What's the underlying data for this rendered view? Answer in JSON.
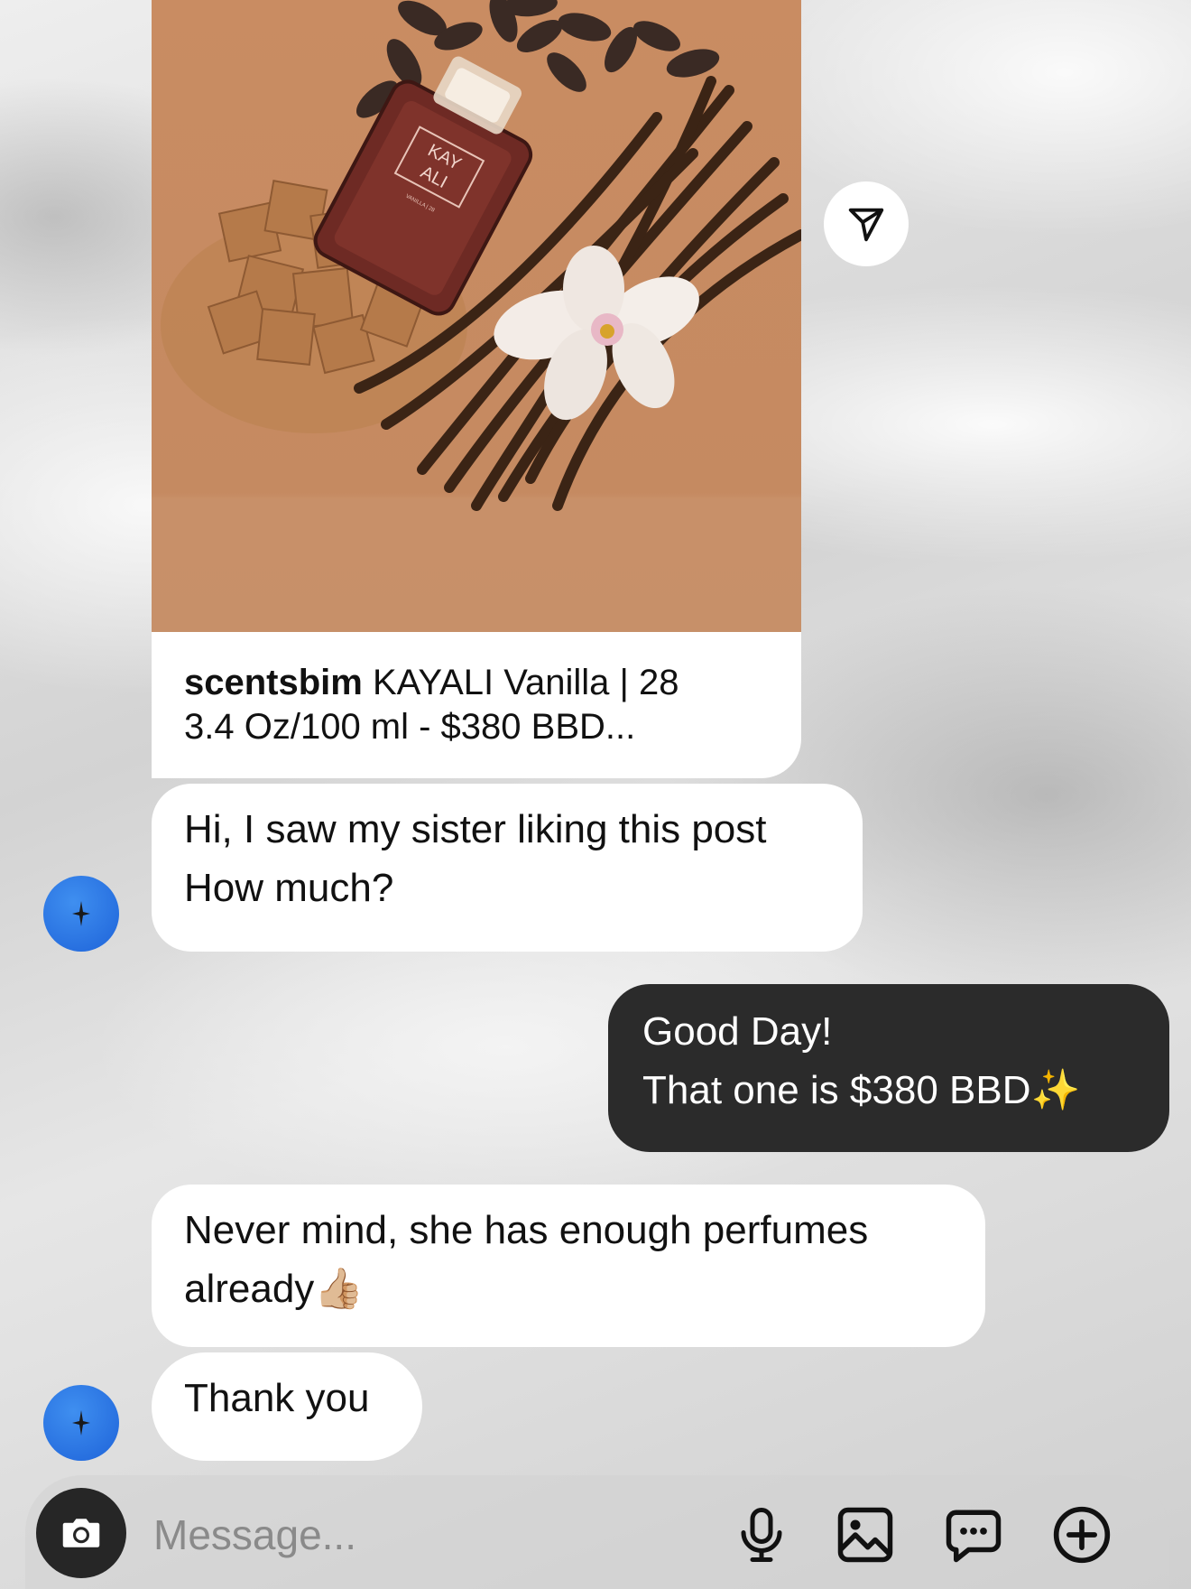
{
  "shared_post": {
    "username": "scentsbim",
    "caption_line1": "KAYALI Vanilla | 28",
    "caption_line2": "3.4 Oz/100 ml - $380 BBD...",
    "bottle_logo_line1": "KAY",
    "bottle_logo_line2": "ALI",
    "bottle_sublabel": "VANILLA | 28"
  },
  "messages": [
    {
      "direction": "incoming",
      "lines": [
        "Hi, I saw my sister liking this post",
        "How much?"
      ]
    },
    {
      "direction": "outgoing",
      "lines": [
        "Good Day!",
        "That one is $380 BBD✨"
      ]
    },
    {
      "direction": "incoming",
      "lines": [
        "Never mind, she has enough perfumes",
        "already👍🏼"
      ]
    },
    {
      "direction": "incoming",
      "lines": [
        "Thank you"
      ]
    }
  ],
  "composer": {
    "placeholder": "Message..."
  },
  "icons": {
    "share": "send-icon",
    "camera": "camera-icon",
    "mic": "microphone-icon",
    "gallery": "image-gallery-icon",
    "sticker": "chat-bubble-dots-icon",
    "plus": "plus-circle-icon"
  },
  "colors": {
    "outgoing_bubble": "#2b2b2b",
    "incoming_bubble": "#ffffff",
    "avatar": "#2d74e8",
    "post_background": "#c68b62"
  }
}
